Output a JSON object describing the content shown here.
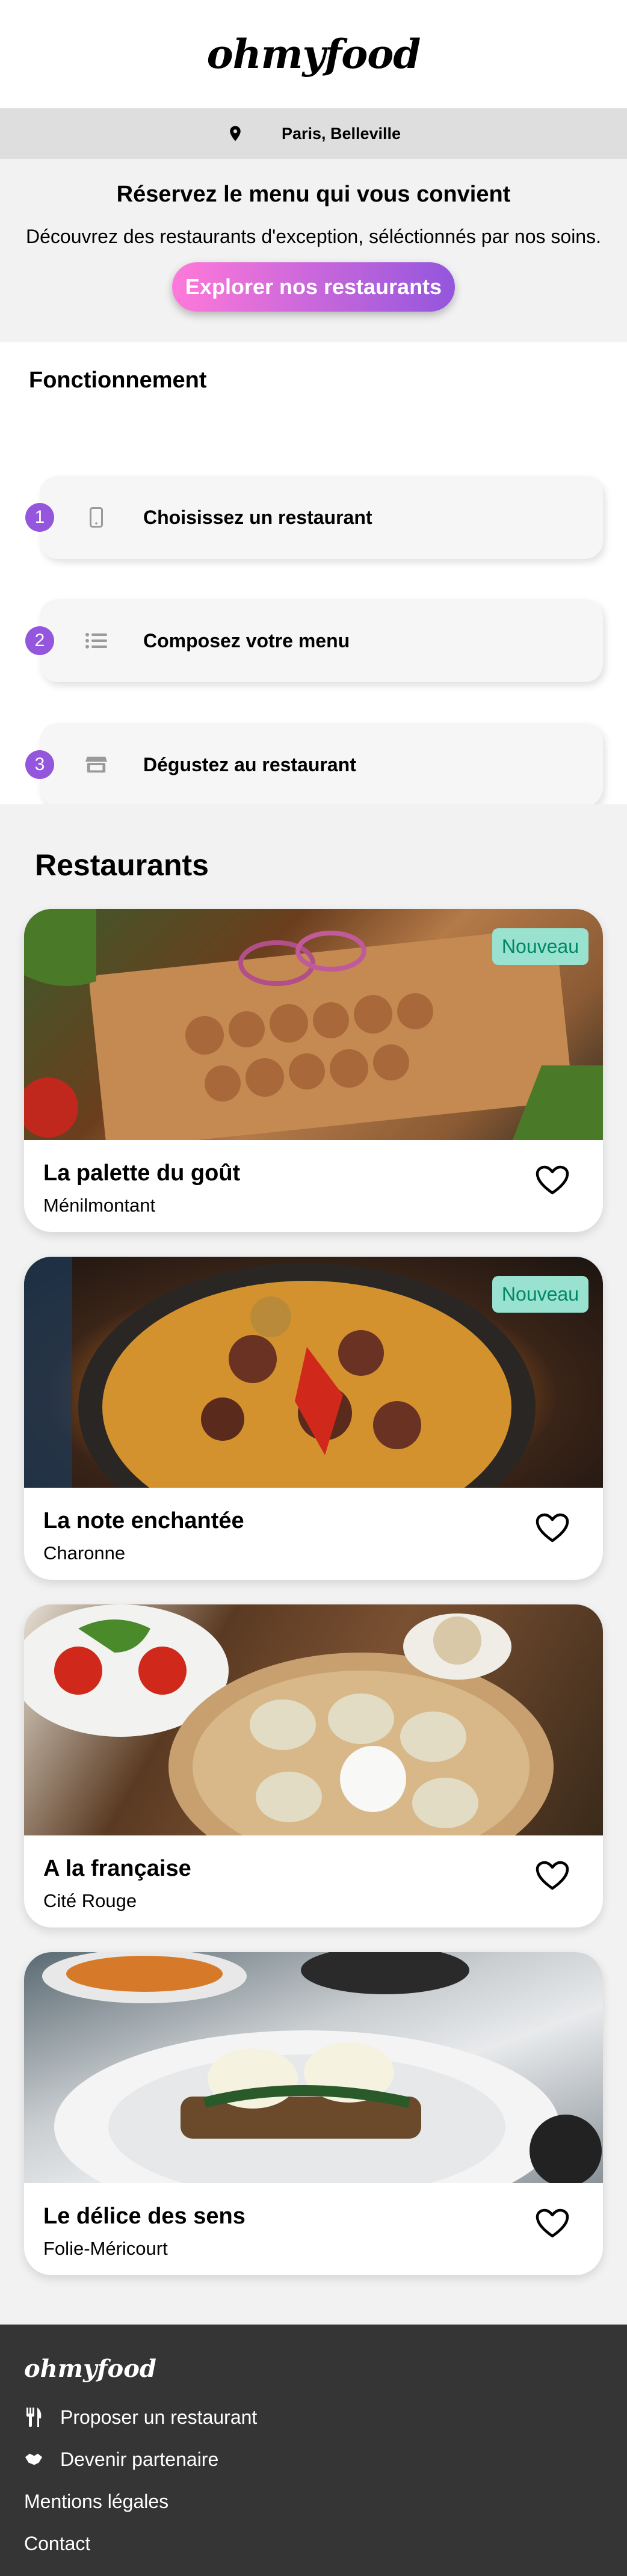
{
  "header": {
    "logo": "ohmyfood"
  },
  "location": {
    "icon": "map-marker-icon",
    "text": "Paris, Belleville"
  },
  "hero": {
    "title": "Réservez le menu qui vous convient",
    "subtitle": "Découvrez des restaurants d'exception, séléctionnés par nos soins.",
    "cta": "Explorer nos restaurants"
  },
  "how": {
    "title": "Fonctionnement",
    "steps": [
      {
        "number": "1",
        "icon": "mobile-icon",
        "label": "Choisissez un restaurant"
      },
      {
        "number": "2",
        "icon": "list-icon",
        "label": "Composez votre menu"
      },
      {
        "number": "3",
        "icon": "store-icon",
        "label": "Dégustez au restaurant"
      }
    ]
  },
  "restaurants": {
    "title": "Restaurants",
    "items": [
      {
        "name": "La palette du goût",
        "area": "Ménilmontant",
        "badge": "Nouveau"
      },
      {
        "name": "La note enchantée",
        "area": "Charonne",
        "badge": "Nouveau"
      },
      {
        "name": "A la française",
        "area": "Cité Rouge",
        "badge": ""
      },
      {
        "name": "Le délice des sens",
        "area": "Folie-Méricourt",
        "badge": ""
      }
    ]
  },
  "footer": {
    "logo": "ohmyfood",
    "links": [
      {
        "icon": "utensils-icon",
        "label": "Proposer un restaurant"
      },
      {
        "icon": "handshake-icon",
        "label": "Devenir partenaire"
      },
      {
        "icon": "",
        "label": "Mentions légales"
      },
      {
        "icon": "",
        "label": "Contact"
      }
    ]
  },
  "colors": {
    "accent": "#9356dc",
    "cta_start": "#ff79da",
    "badge_bg": "#99e2d0",
    "badge_text": "#008766",
    "footer_bg": "#353535"
  }
}
